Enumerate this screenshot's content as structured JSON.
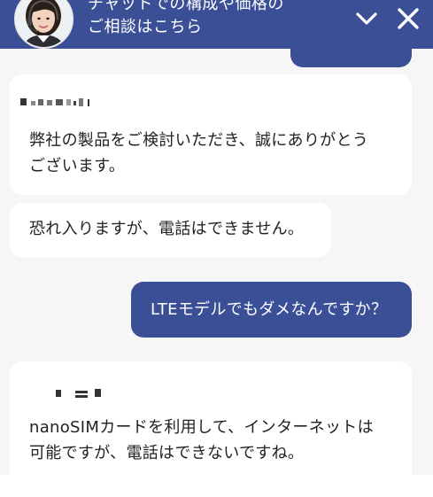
{
  "header": {
    "title_line1": "チャットでの構成や価格の",
    "title_line2": "ご相談はこちら",
    "minimize_icon": "chevron-down-icon",
    "close_icon": "close-icon"
  },
  "colors": {
    "header_bg": "#3b4f97",
    "user_bubble_bg": "#3b4f97",
    "bot_bubble_bg": "#ffffff",
    "chat_bg": "#f6f6f6"
  },
  "messages": [
    {
      "role": "bot",
      "lines": [
        "弊社の製品をご検討いただき、誠にありがとう",
        "ございます。"
      ]
    },
    {
      "role": "bot",
      "lines": [
        "恐れ入りますが、電話はできません。"
      ]
    },
    {
      "role": "user",
      "lines": [
        "LTEモデルでもダメなんですか？"
      ]
    },
    {
      "role": "bot",
      "lines": [
        "nanoSIMカードを利用して、インターネットは",
        "可能ですが、電話はできないですね。"
      ]
    }
  ]
}
